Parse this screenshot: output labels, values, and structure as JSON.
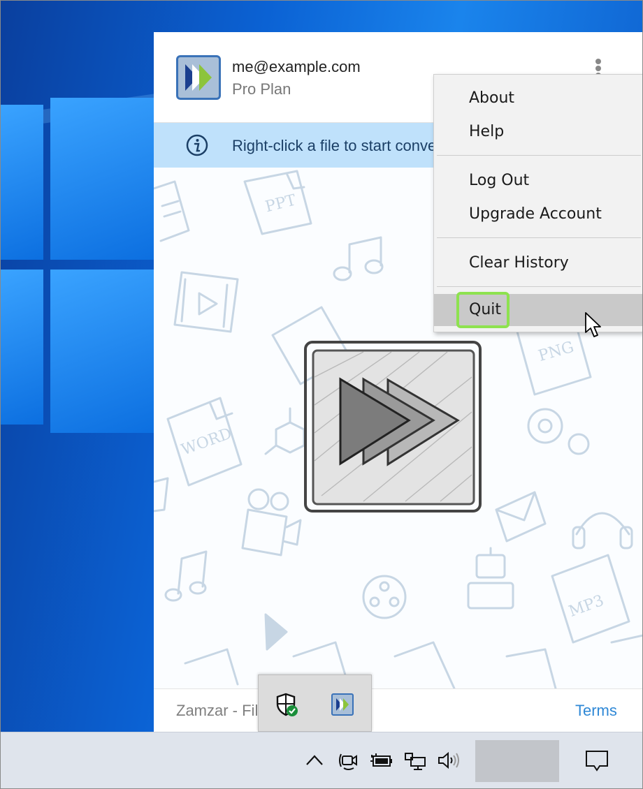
{
  "account": {
    "email": "me@example.com",
    "plan": "Pro Plan"
  },
  "banner": {
    "text": "Right-click a file to start converting"
  },
  "menu": {
    "items": [
      {
        "label": "About"
      },
      {
        "label": "Help"
      },
      {
        "label": "Log Out"
      },
      {
        "label": "Upgrade Account"
      },
      {
        "label": "Clear History"
      },
      {
        "label": "Quit"
      }
    ]
  },
  "footer": {
    "text": "Zamzar - File Converter",
    "terms_label": "Terms"
  },
  "doodles": {
    "ppt": "PPT",
    "png": "PNG",
    "word": "WORD",
    "mp3": "MP3"
  },
  "colors": {
    "banner_bg": "#bfe1fb",
    "quit_highlight": "#8ee24f",
    "link": "#2f88d6",
    "logo_arrow_1": "#1b3f8f",
    "logo_arrow_2": "#ffffff",
    "logo_arrow_3": "#8cc43b"
  }
}
